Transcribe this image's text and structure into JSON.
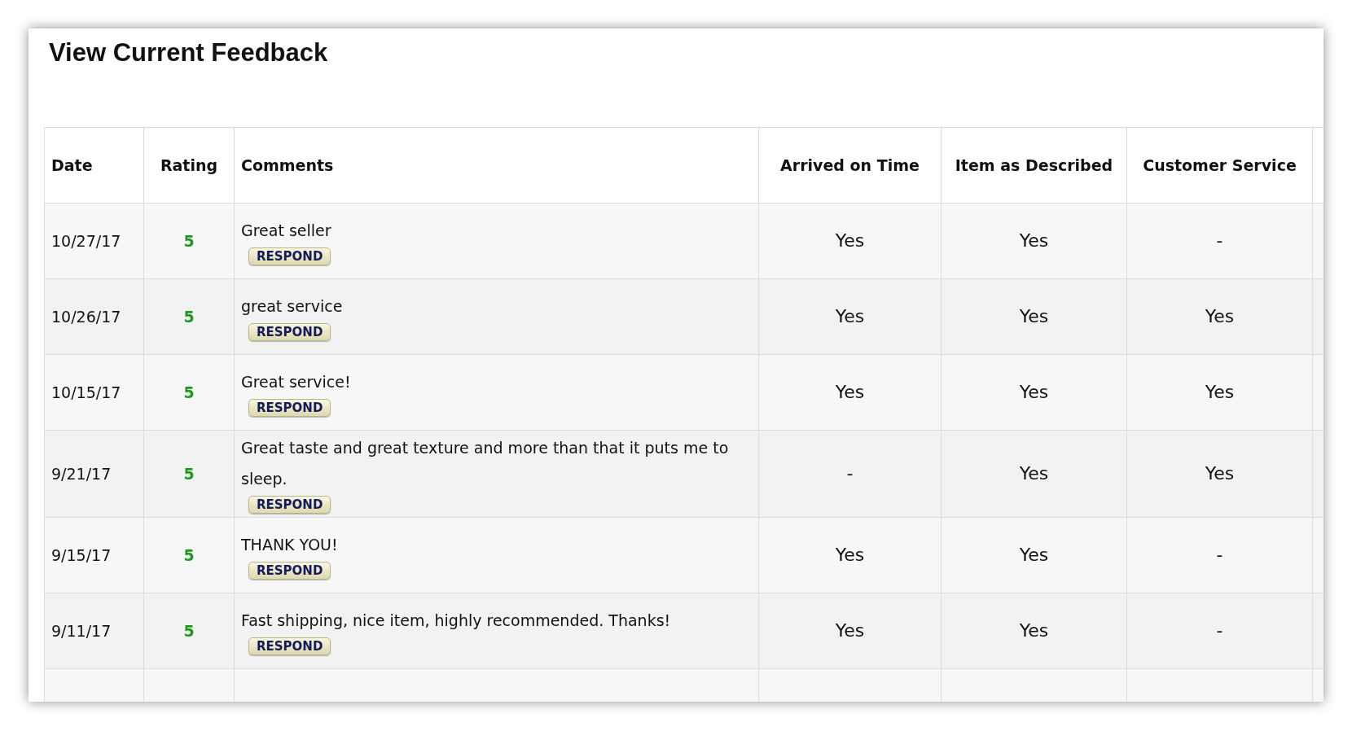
{
  "title": "View Current Feedback",
  "table": {
    "columns": [
      "Date",
      "Rating",
      "Comments",
      "Arrived on Time",
      "Item as Described",
      "Customer Service"
    ],
    "rows": [
      {
        "date": "10/27/17",
        "rating": "5",
        "comment": "Great seller",
        "button": "RESPOND",
        "arrived": "Yes",
        "described": "Yes",
        "service": "-"
      },
      {
        "date": "10/26/17",
        "rating": "5",
        "comment": "great service",
        "button": "RESPOND",
        "arrived": "Yes",
        "described": "Yes",
        "service": "Yes"
      },
      {
        "date": "10/15/17",
        "rating": "5",
        "comment": "Great service!",
        "button": "RESPOND",
        "arrived": "Yes",
        "described": "Yes",
        "service": "Yes"
      },
      {
        "date": "9/21/17",
        "rating": "5",
        "comment": "Great taste and great texture and more than that it puts me to sleep.",
        "button": "RESPOND",
        "arrived": "-",
        "described": "Yes",
        "service": "Yes"
      },
      {
        "date": "9/15/17",
        "rating": "5",
        "comment": "THANK YOU!",
        "button": "RESPOND",
        "arrived": "Yes",
        "described": "Yes",
        "service": "-"
      },
      {
        "date": "9/11/17",
        "rating": "5",
        "comment": "Fast shipping, nice item, highly recommended. Thanks!",
        "button": "RESPOND",
        "arrived": "Yes",
        "described": "Yes",
        "service": "-"
      }
    ]
  }
}
